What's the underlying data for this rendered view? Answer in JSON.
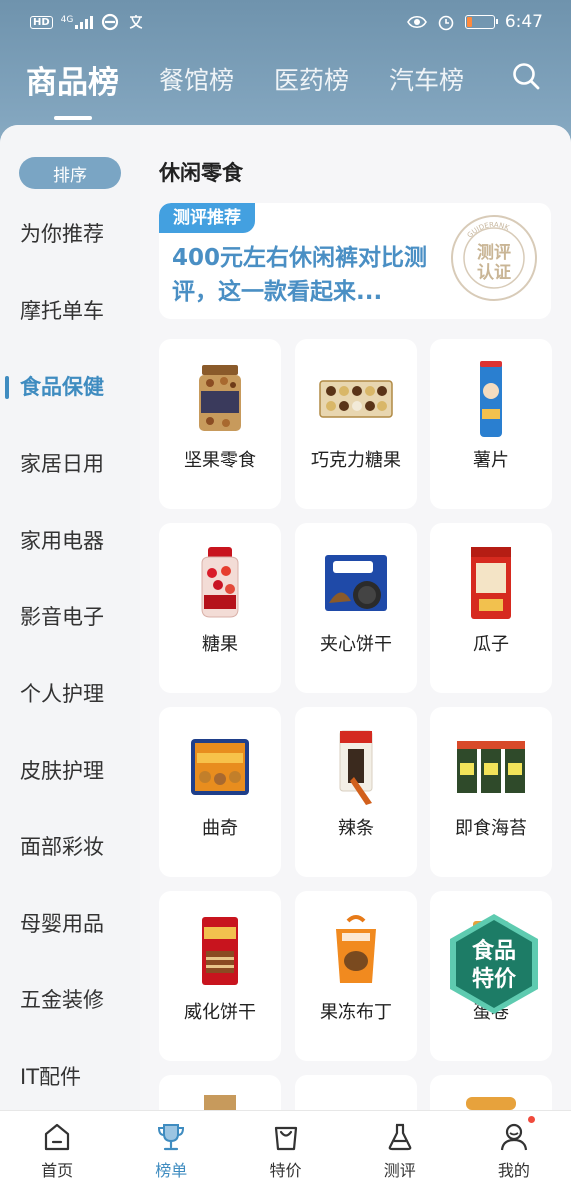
{
  "status_bar": {
    "left_badge": "HD",
    "network": "4G",
    "time": "6:47",
    "battery_level": 0.2
  },
  "top_tabs": [
    {
      "label": "商品榜",
      "active": true
    },
    {
      "label": "餐馆榜",
      "active": false
    },
    {
      "label": "医药榜",
      "active": false
    },
    {
      "label": "汽车榜",
      "active": false
    }
  ],
  "sidebar": {
    "sort_label": "排序",
    "items": [
      {
        "label": "为你推荐"
      },
      {
        "label": "摩托单车"
      },
      {
        "label": "食品保健",
        "active": true
      },
      {
        "label": "家居日用"
      },
      {
        "label": "家用电器"
      },
      {
        "label": "影音电子"
      },
      {
        "label": "个人护理"
      },
      {
        "label": "皮肤护理"
      },
      {
        "label": "面部彩妆"
      },
      {
        "label": "母婴用品"
      },
      {
        "label": "五金装修"
      },
      {
        "label": "IT配件"
      }
    ]
  },
  "content": {
    "section_title": "休闲零食",
    "banner": {
      "tag": "测评推荐",
      "text": "400元左右休闲裤对比测评，这一款看起来...",
      "seal_top": "GUIDERANK",
      "seal_line1": "测评",
      "seal_line2": "认证"
    },
    "categories": [
      {
        "label": "坚果零食",
        "icon": "nut-jar-icon"
      },
      {
        "label": "巧克力糖果",
        "icon": "chocolate-box-icon"
      },
      {
        "label": "薯片",
        "icon": "chips-can-icon"
      },
      {
        "label": "糖果",
        "icon": "candy-jar-icon"
      },
      {
        "label": "夹心饼干",
        "icon": "sandwich-cookie-icon"
      },
      {
        "label": "瓜子",
        "icon": "seeds-bag-icon"
      },
      {
        "label": "曲奇",
        "icon": "cookie-tin-icon"
      },
      {
        "label": "辣条",
        "icon": "spicy-strip-icon"
      },
      {
        "label": "即食海苔",
        "icon": "seaweed-pack-icon"
      },
      {
        "label": "威化饼干",
        "icon": "wafer-pack-icon"
      },
      {
        "label": "果冻布丁",
        "icon": "jelly-box-icon"
      },
      {
        "label": "蛋卷",
        "icon": "egg-roll-icon"
      }
    ],
    "promo": {
      "line1": "食品",
      "line2": "特价"
    }
  },
  "bottom_nav": [
    {
      "label": "首页",
      "icon": "home-icon"
    },
    {
      "label": "榜单",
      "icon": "trophy-icon",
      "active": true
    },
    {
      "label": "特价",
      "icon": "shopping-bag-icon"
    },
    {
      "label": "测评",
      "icon": "flask-icon"
    },
    {
      "label": "我的",
      "icon": "profile-icon",
      "badge": true
    }
  ],
  "colors": {
    "accent": "#3f8cc0",
    "header": "#7aa0ba",
    "banner_tag": "#43a0e0",
    "promo_green": "#1d7c66"
  }
}
